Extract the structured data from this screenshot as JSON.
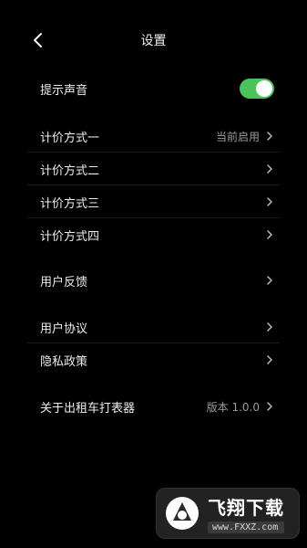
{
  "header": {
    "title": "设置",
    "back_icon": "chevron-left-icon"
  },
  "sound": {
    "label": "提示声音",
    "enabled": true,
    "toggle_color": "#4cc35a"
  },
  "pricing": [
    {
      "label": "计价方式一",
      "value": "当前启用"
    },
    {
      "label": "计价方式二",
      "value": ""
    },
    {
      "label": "计价方式三",
      "value": ""
    },
    {
      "label": "计价方式四",
      "value": ""
    }
  ],
  "feedback": {
    "label": "用户反馈"
  },
  "legal": [
    {
      "label": "用户协议"
    },
    {
      "label": "隐私政策"
    }
  ],
  "about": {
    "label": "关于出租车打表器",
    "value": "版本 1.0.0"
  },
  "watermark": {
    "brand": "飞翔下载",
    "url": "www.FXXZ.com"
  }
}
